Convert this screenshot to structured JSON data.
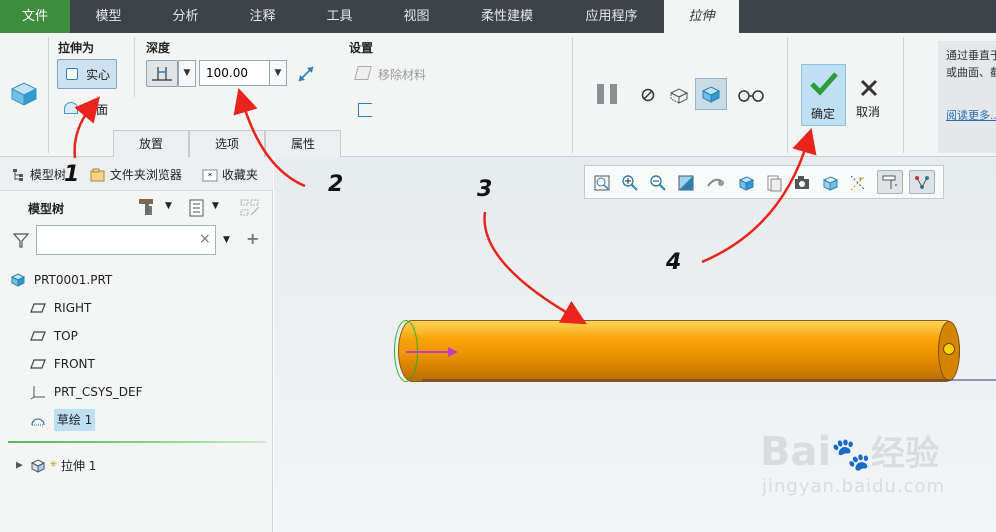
{
  "menu": {
    "tabs": [
      "文件",
      "模型",
      "分析",
      "注释",
      "工具",
      "视图",
      "柔性建模",
      "应用程序",
      "拉伸"
    ]
  },
  "ribbon": {
    "extrude_as_label": "拉伸为",
    "solid_label": "实心",
    "surface_label": "曲面",
    "depth_label": "深度",
    "depth_value": "100.00",
    "settings_label": "设置",
    "remove_material_label": "移除材料",
    "bottom_tabs": [
      "放置",
      "选项",
      "属性"
    ],
    "confirm_label": "确定",
    "cancel_label": "取消",
    "help_text_1": "通过垂直于",
    "help_text_2": "或曲面、截",
    "help_link": "阅读更多..."
  },
  "panel": {
    "tabs": [
      "模型树",
      "文件夹浏览器",
      "收藏夹"
    ],
    "model_tree_label": "模型树",
    "filter_placeholder": "",
    "tree": [
      "PRT0001.PRT",
      "RIGHT",
      "TOP",
      "FRONT",
      "PRT_CSYS_DEF",
      "草绘 1",
      "拉伸 1"
    ]
  },
  "annotations": [
    "1",
    "2",
    "3",
    "4"
  ],
  "watermark": {
    "brand": "Bai",
    "brand2": "经验",
    "url": "jingyan.baidu.com"
  },
  "colors": {
    "menubar": "#3c4448",
    "file_tab": "#3e8e3e",
    "cylinder": "#f39c00",
    "arrow": "#e8241c"
  }
}
